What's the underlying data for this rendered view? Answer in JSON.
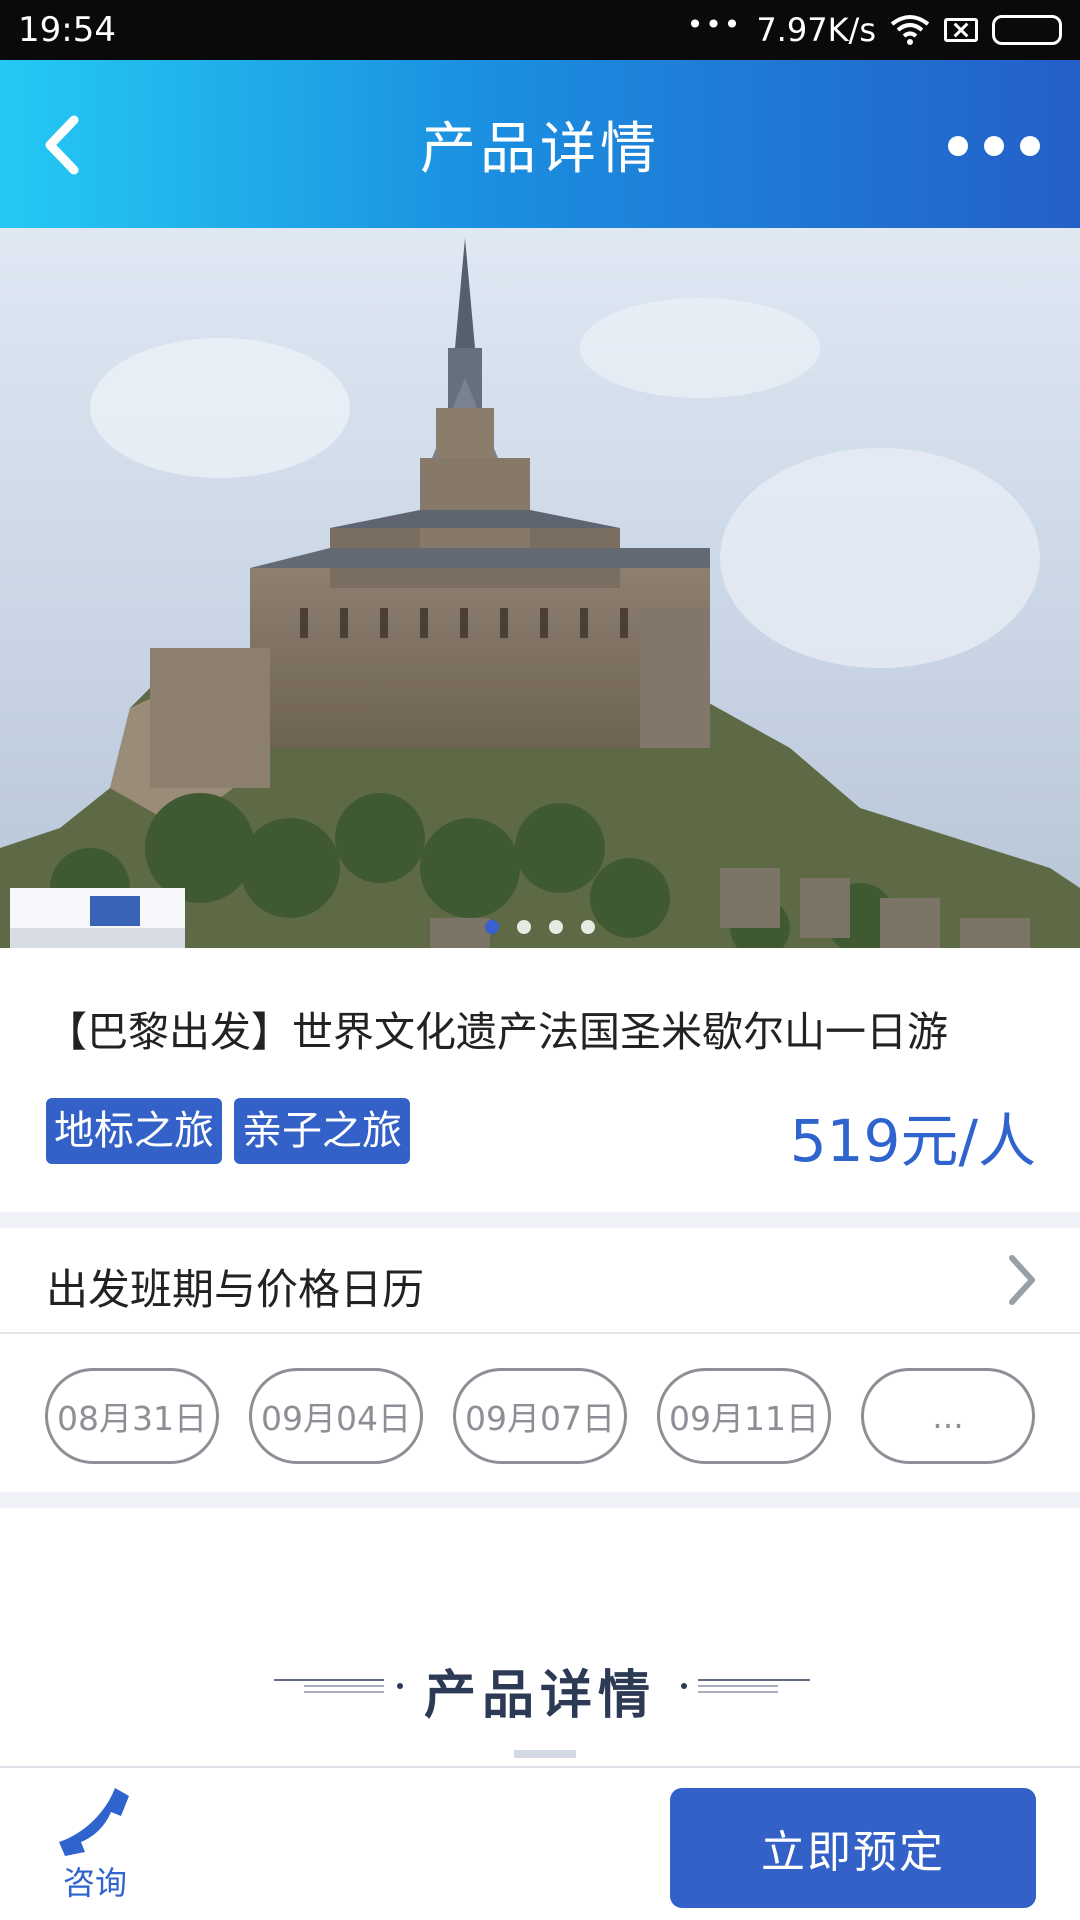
{
  "status_bar": {
    "time": "19:54",
    "network_speed": "7.97K/s",
    "icons": [
      "more-dots-icon",
      "wifi-icon",
      "sim-disabled-icon",
      "battery-icon"
    ]
  },
  "header": {
    "title": "产品详情",
    "back_icon": "chevron-left-icon",
    "more_icon": "more-horizontal-icon"
  },
  "banner": {
    "image_subject": "Mont-Saint-Michel abbey",
    "slide_count": 4,
    "active_slide": 1
  },
  "product": {
    "title": "【巴黎出发】世界文化遗产法国圣米歇尔山一日游",
    "tags": [
      "地标之旅",
      "亲子之旅"
    ],
    "price": "519元/人"
  },
  "calendar": {
    "label": "出发班期与价格日历",
    "dates": [
      "08月31日",
      "09月04日",
      "09月07日",
      "09月11日",
      "..."
    ]
  },
  "details_section": {
    "title": "产品详情"
  },
  "bottom_bar": {
    "consult_label": "咨询",
    "book_label": "立即预定"
  },
  "colors": {
    "accent": "#3361c7",
    "header_gradient_start": "#25c9f4",
    "header_gradient_end": "#2460c8",
    "price": "#2f63cd",
    "pill_border": "#8d8f96"
  }
}
